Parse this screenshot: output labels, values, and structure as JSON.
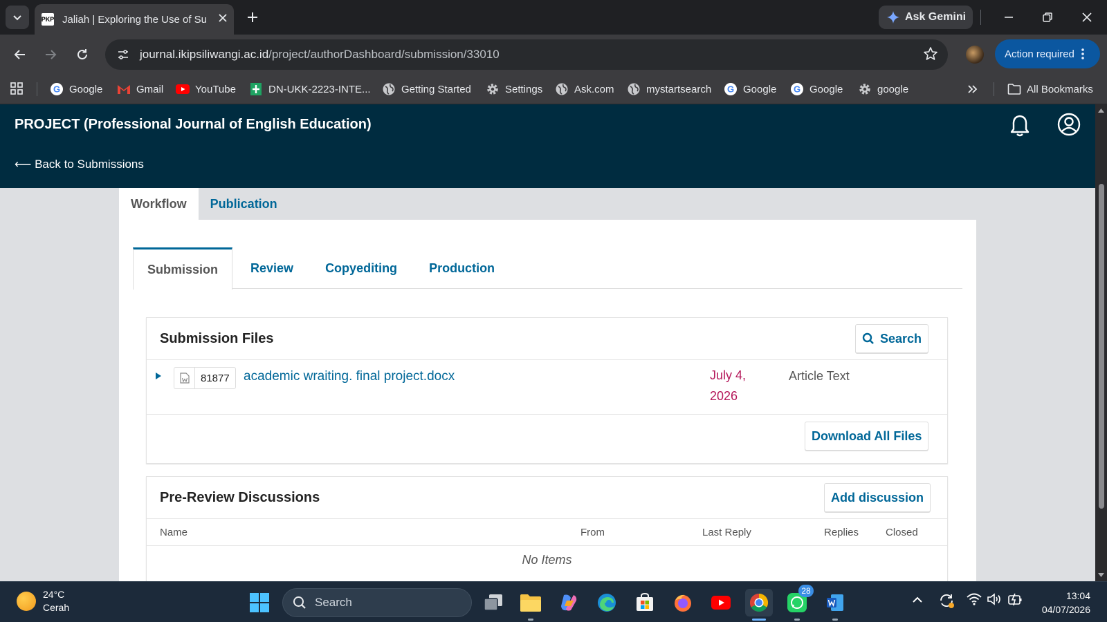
{
  "browser": {
    "tab_title": "Jaliah | Exploring the Use of Sul",
    "favicon_text": "PKP",
    "gemini_label": "Ask Gemini",
    "url_host": "journal.ikipsiliwangi.ac.id",
    "url_path": "/project/authorDashboard/submission/33010",
    "action_required": "Action required",
    "bookmarks": [
      {
        "label": "Google",
        "icon": "google-icon"
      },
      {
        "label": "Gmail",
        "icon": "gmail-icon"
      },
      {
        "label": "YouTube",
        "icon": "youtube-icon"
      },
      {
        "label": "DN-UKK-2223-INTE...",
        "icon": "sheets-icon"
      },
      {
        "label": "Getting Started",
        "icon": "globe-icon"
      },
      {
        "label": "Settings",
        "icon": "gear-icon"
      },
      {
        "label": "Ask.com",
        "icon": "globe-icon"
      },
      {
        "label": "mystartsearch",
        "icon": "globe-icon"
      },
      {
        "label": "Google",
        "icon": "google-icon"
      },
      {
        "label": "Google",
        "icon": "google-icon"
      },
      {
        "label": "google",
        "icon": "gear-icon"
      }
    ],
    "all_bookmarks": "All Bookmarks"
  },
  "app": {
    "journal_title": "PROJECT (Professional Journal of English Education)",
    "back_link": "⟵ Back to Submissions",
    "main_tabs": [
      "Workflow",
      "Publication"
    ],
    "sub_tabs": [
      "Submission",
      "Review",
      "Copyediting",
      "Production"
    ]
  },
  "submission_files": {
    "title": "Submission Files",
    "search_label": "Search",
    "file": {
      "id": "81877",
      "name": "academic wraiting. final project.docx",
      "date": "July 4, 2026",
      "type": "Article Text"
    },
    "download_all": "Download All Files"
  },
  "discussions": {
    "title": "Pre-Review Discussions",
    "add_label": "Add discussion",
    "columns": [
      "Name",
      "From",
      "Last Reply",
      "Replies",
      "Closed"
    ],
    "empty": "No Items"
  },
  "taskbar": {
    "temperature": "24°C",
    "condition": "Cerah",
    "search_label": "Search",
    "whatsapp_badge": "28",
    "time": "13:04",
    "date": "04/07/2026"
  },
  "colors": {
    "header_bg": "#002c40",
    "link": "#006798",
    "date": "#b5195b"
  }
}
